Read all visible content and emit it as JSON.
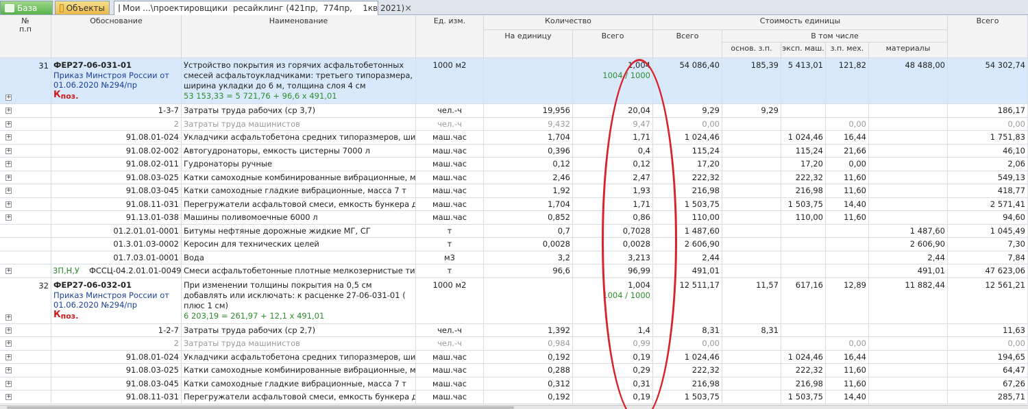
{
  "tabs": [
    {
      "label": "База",
      "icon": "database-icon"
    },
    {
      "label": "Объекты",
      "icon": "folder-icon"
    },
    {
      "label": "Мои ...\\проектировщики  ресайклинг (421пр,  774пр,    1кв 2021)",
      "icon": "document-icon"
    }
  ],
  "tab_close": "×",
  "columns": {
    "num": "№\nп.п",
    "basis": "Обоснование",
    "name": "Наименование",
    "unit": "Ед. изм.",
    "qty_group": "Количество",
    "qty_per_unit": "На единицу",
    "qty_total": "Всего",
    "cost_group": "Стоимость единицы",
    "cost_total": "Всего",
    "including": "В том числе",
    "base_wage": "основ. з.п.",
    "machine_op": "эксп. маш.",
    "machine_wage": "з.п. мех.",
    "materials": "материалы",
    "grand_total": "Всего"
  },
  "positions": [
    {
      "num": "31",
      "code": "ФЕР27-06-031-01",
      "order": "Приказ Минстроя России от 01.06.2020 №294/пр",
      "k_label": "К",
      "k_sub": "поз.",
      "name": "Устройство покрытия из горячих асфальтобетонных смесей асфальтоукладчиками: третьего типоразмера, ширина укладки до 6 м, толщина слоя 4 см",
      "formula": "53 153,33 = 5 721,76 + 96,6 x 491,01",
      "unit": "1000 м2",
      "qty_total": "1,004",
      "qty_ratio": "1004 / 1000",
      "cost_total": "54 086,40",
      "base_wage": "185,39",
      "machine_op": "5 413,01",
      "machine_wage": "121,82",
      "materials": "48 488,00",
      "grand_total": "54 302,74",
      "rows": [
        {
          "code": "1-3-7",
          "name": "Затраты труда рабочих (ср 3,7)",
          "unit": "чел.-ч",
          "per_unit": "19,956",
          "total": "20,04",
          "cost": "9,29",
          "base_wage": "9,29",
          "machine_op": "",
          "machine_wage": "",
          "materials": "",
          "grand": "186,17",
          "grey": false,
          "exp": true
        },
        {
          "code": "2",
          "name": "Затраты труда машинистов",
          "unit": "чел.-ч",
          "per_unit": "9,432",
          "total": "9,47",
          "cost": "0,00",
          "base_wage": "",
          "machine_op": "",
          "machine_wage": "0,00",
          "materials": "",
          "grand": "0,00",
          "grey": true,
          "exp": true
        },
        {
          "code": "91.08.01-024",
          "name": "Укладчики асфальтобетона средних типоразмеров, шир...",
          "unit": "маш.час",
          "per_unit": "1,704",
          "total": "1,71",
          "cost": "1 024,46",
          "base_wage": "",
          "machine_op": "1 024,46",
          "machine_wage": "16,44",
          "materials": "",
          "grand": "1 751,83",
          "grey": false,
          "exp": true
        },
        {
          "code": "91.08.02-002",
          "name": "Автогудронаторы, емкость цистерны 7000 л",
          "unit": "маш.час",
          "per_unit": "0,396",
          "total": "0,4",
          "cost": "115,24",
          "base_wage": "",
          "machine_op": "115,24",
          "machine_wage": "21,66",
          "materials": "",
          "grand": "46,10",
          "grey": false,
          "exp": true
        },
        {
          "code": "91.08.02-011",
          "name": "Гудронаторы ручные",
          "unit": "маш.час",
          "per_unit": "0,12",
          "total": "0,12",
          "cost": "17,20",
          "base_wage": "",
          "machine_op": "17,20",
          "machine_wage": "0,00",
          "materials": "",
          "grand": "2,06",
          "grey": false,
          "exp": true
        },
        {
          "code": "91.08.03-025",
          "name": "Катки самоходные комбинированные вибрационные, ма...",
          "unit": "маш.час",
          "per_unit": "2,46",
          "total": "2,47",
          "cost": "222,32",
          "base_wage": "",
          "machine_op": "222,32",
          "machine_wage": "11,60",
          "materials": "",
          "grand": "549,13",
          "grey": false,
          "exp": true
        },
        {
          "code": "91.08.03-045",
          "name": "Катки самоходные гладкие вибрационные, масса 7 т",
          "unit": "маш.час",
          "per_unit": "1,92",
          "total": "1,93",
          "cost": "216,98",
          "base_wage": "",
          "machine_op": "216,98",
          "machine_wage": "11,60",
          "materials": "",
          "grand": "418,77",
          "grey": false,
          "exp": true
        },
        {
          "code": "91.08.11-031",
          "name": "Перегружатели асфальтовой смеси, емкость бункера до...",
          "unit": "маш.час",
          "per_unit": "1,704",
          "total": "1,71",
          "cost": "1 503,75",
          "base_wage": "",
          "machine_op": "1 503,75",
          "machine_wage": "14,40",
          "materials": "",
          "grand": "2 571,41",
          "grey": false,
          "exp": true
        },
        {
          "code": "91.13.01-038",
          "name": "Машины поливомоечные 6000 л",
          "unit": "маш.час",
          "per_unit": "0,852",
          "total": "0,86",
          "cost": "110,00",
          "base_wage": "",
          "machine_op": "110,00",
          "machine_wage": "11,60",
          "materials": "",
          "grand": "94,60",
          "grey": false,
          "exp": true
        },
        {
          "code": "01.2.01.01-0001",
          "name": "Битумы нефтяные дорожные жидкие МГ, СГ",
          "unit": "т",
          "per_unit": "0,7",
          "total": "0,7028",
          "cost": "1 487,60",
          "base_wage": "",
          "machine_op": "",
          "machine_wage": "",
          "materials": "1 487,60",
          "grand": "1 045,49",
          "grey": false,
          "exp": false
        },
        {
          "code": "01.3.01.03-0002",
          "name": "Керосин для технических целей",
          "unit": "т",
          "per_unit": "0,0028",
          "total": "0,0028",
          "cost": "2 606,90",
          "base_wage": "",
          "machine_op": "",
          "machine_wage": "",
          "materials": "2 606,90",
          "grand": "7,30",
          "grey": false,
          "exp": false
        },
        {
          "code": "01.7.03.01-0001",
          "name": "Вода",
          "unit": "м3",
          "per_unit": "3,2",
          "total": "3,213",
          "cost": "2,44",
          "base_wage": "",
          "machine_op": "",
          "machine_wage": "",
          "materials": "2,44",
          "grand": "7,84",
          "grey": false,
          "exp": false
        },
        {
          "code": "ФССЦ-04.2.01.01-0049",
          "prefix": "3П,Н,У",
          "name": "Смеси асфальтобетонные плотные мелкозернистые тип...",
          "unit": "т",
          "per_unit": "96,6",
          "total": "96,99",
          "cost": "491,01",
          "base_wage": "",
          "machine_op": "",
          "machine_wage": "",
          "materials": "491,01",
          "grand": "47 623,06",
          "grey": false,
          "exp": true
        }
      ]
    },
    {
      "num": "32",
      "code": "ФЕР27-06-032-01",
      "order": "Приказ Минстроя России от 01.06.2020 №294/пр",
      "k_label": "К",
      "k_sub": "поз.",
      "name": "При изменении толщины покрытия на 0,5 см добавлять или исключать: к расценке 27-06-031-01 ( плюс 1 см)",
      "formula": "6 203,19 = 261,97 + 12,1 x 491,01",
      "unit": "1000 м2",
      "qty_total": "1,004",
      "qty_ratio": "1004 / 1000",
      "cost_total": "12 511,17",
      "base_wage": "11,57",
      "machine_op": "617,16",
      "machine_wage": "12,89",
      "materials": "11 882,44",
      "grand_total": "12 561,21",
      "rows": [
        {
          "code": "1-2-7",
          "name": "Затраты труда рабочих (ср 2,7)",
          "unit": "чел.-ч",
          "per_unit": "1,392",
          "total": "1,4",
          "cost": "8,31",
          "base_wage": "8,31",
          "machine_op": "",
          "machine_wage": "",
          "materials": "",
          "grand": "11,63",
          "grey": false,
          "exp": true
        },
        {
          "code": "2",
          "name": "Затраты труда машинистов",
          "unit": "чел.-ч",
          "per_unit": "0,984",
          "total": "0,99",
          "cost": "0,00",
          "base_wage": "",
          "machine_op": "",
          "machine_wage": "0,00",
          "materials": "",
          "grand": "0,00",
          "grey": true,
          "exp": true
        },
        {
          "code": "91.08.01-024",
          "name": "Укладчики асфальтобетона средних типоразмеров, шир...",
          "unit": "маш.час",
          "per_unit": "0,192",
          "total": "0,19",
          "cost": "1 024,46",
          "base_wage": "",
          "machine_op": "1 024,46",
          "machine_wage": "16,44",
          "materials": "",
          "grand": "194,65",
          "grey": false,
          "exp": true
        },
        {
          "code": "91.08.03-025",
          "name": "Катки самоходные комбинированные вибрационные, ма...",
          "unit": "маш.час",
          "per_unit": "0,288",
          "total": "0,29",
          "cost": "222,32",
          "base_wage": "",
          "machine_op": "222,32",
          "machine_wage": "11,60",
          "materials": "",
          "grand": "64,47",
          "grey": false,
          "exp": true
        },
        {
          "code": "91.08.03-045",
          "name": "Катки самоходные гладкие вибрационные, масса 7 т",
          "unit": "маш.час",
          "per_unit": "0,312",
          "total": "0,31",
          "cost": "216,98",
          "base_wage": "",
          "machine_op": "216,98",
          "machine_wage": "11,60",
          "materials": "",
          "grand": "67,26",
          "grey": false,
          "exp": true
        },
        {
          "code": "91.08.11-031",
          "name": "Перегружатели асфальтовой смеси, емкость бункера до...",
          "unit": "маш.час",
          "per_unit": "0,192",
          "total": "0,19",
          "cost": "1 503,75",
          "base_wage": "",
          "machine_op": "1 503,75",
          "machine_wage": "14,40",
          "materials": "",
          "grand": "285,71",
          "grey": false,
          "exp": true
        }
      ]
    }
  ],
  "colors": {
    "selected_row": "#d7e9fa",
    "annotation": "#d9232b",
    "green_text": "#2e8b2e",
    "blue_text": "#1a3f9b"
  }
}
